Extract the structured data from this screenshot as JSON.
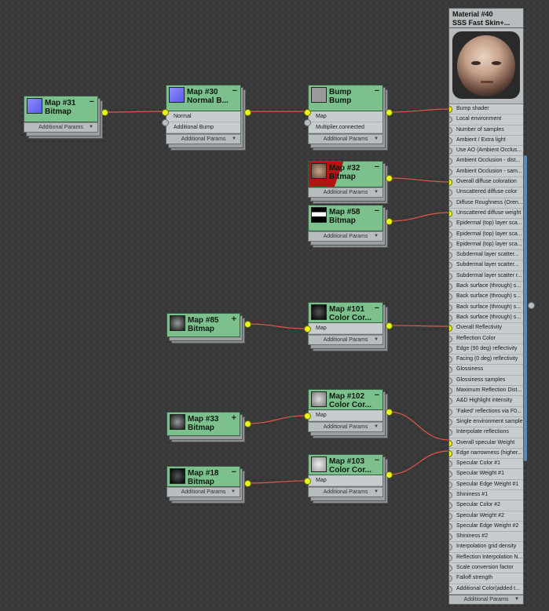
{
  "nodes": {
    "map31": {
      "title": "Map #31",
      "subtitle": "Bitmap",
      "params": "Additional Params",
      "collapse": "−"
    },
    "map30": {
      "title": "Map #30",
      "subtitle": "Normal  B...",
      "row1": "Normal",
      "row2": "Additional Bump",
      "params": "Additional Params",
      "collapse": "−"
    },
    "bump": {
      "title": "Bump",
      "subtitle": "Bump",
      "row1": "Map",
      "row2": "Multiplier.connected",
      "params": "Additional Params",
      "collapse": "−"
    },
    "map32": {
      "title": "Map #32",
      "subtitle": "Bitmap",
      "params": "Additional Params",
      "collapse": "−"
    },
    "map58": {
      "title": "Map #58",
      "subtitle": "Bitmap",
      "params": "Additional Params",
      "collapse": "−"
    },
    "map85": {
      "title": "Map #85",
      "subtitle": "Bitmap",
      "collapse": "+"
    },
    "map101": {
      "title": "Map #101",
      "subtitle": "Color  Cor...",
      "row1": "Map",
      "params": "Additional Params",
      "collapse": "−"
    },
    "map102": {
      "title": "Map #102",
      "subtitle": "Color  Cor...",
      "row1": "Map",
      "params": "Additional Params",
      "collapse": "−"
    },
    "map33": {
      "title": "Map #33",
      "subtitle": "Bitmap",
      "collapse": "+"
    },
    "map18": {
      "title": "Map #18",
      "subtitle": "Bitmap",
      "params": "Additional Params",
      "collapse": "−"
    },
    "map103": {
      "title": "Map #103",
      "subtitle": "Color  Cor...",
      "row1": "Map",
      "params": "Additional Params",
      "collapse": "−"
    }
  },
  "material": {
    "title": "Material #40",
    "subtitle": "SSS Fast Skin+...",
    "params": "Additional Params",
    "rows": [
      "Bump shader",
      "Local environment",
      "Number of samples",
      "Ambient / Extra light",
      "Use AO (Ambient Occlus...",
      "Ambient Occlusion - dist...",
      "Ambient Occlusion - sam...",
      "Overall diffuse coloration",
      "Unscattered diffuse color",
      "Diffuse Roughness (Oren...",
      "Unscattered diffuse weight",
      "Epidermal (top) layer sca...",
      "Epidermal (top) layer sca...",
      "Epidermal (top) layer sca...",
      "Subdermal layer scatter...",
      "Subdermal layer scatter...",
      "Subdermal layer scatter r...",
      "Back surface (through) s...",
      "Back surface (through) s...",
      "Back surface (through) s...",
      "Back surface (through) s...",
      "Overall Reflectivity",
      "Reflection Color",
      "Edge (90 deg) reflectivity",
      "Facing (0 deg) reflectivity",
      "Glossiness",
      "Glossiness samples",
      "Maximum Reflection Dist...",
      "A&D Highlight intensity",
      "'Faked' reflections via F0...",
      "Single environment sample",
      "Interpolate reflections",
      "Overall specular Weight",
      "Edge narrowness (higher...",
      "Specular Color #1",
      "Specular Weight #1",
      "Specular Edge Weight #1",
      "Shininess #1",
      "Specular Color #2",
      "Specular Weight #2",
      "Specular Edge Weight #2",
      "Shininess #2",
      "Interpolation grid density",
      "Reflection Interpolation N...",
      "Scale conversion factor",
      "Falloff strength",
      "Additional Color(added t..."
    ],
    "connected_rows": [
      0,
      7,
      10,
      21,
      32,
      33
    ]
  },
  "colors": {
    "node_header": "#7cc08e",
    "port_connected": "#e8f51a",
    "wire": "#e2564a",
    "background": "#3a3a3a"
  }
}
